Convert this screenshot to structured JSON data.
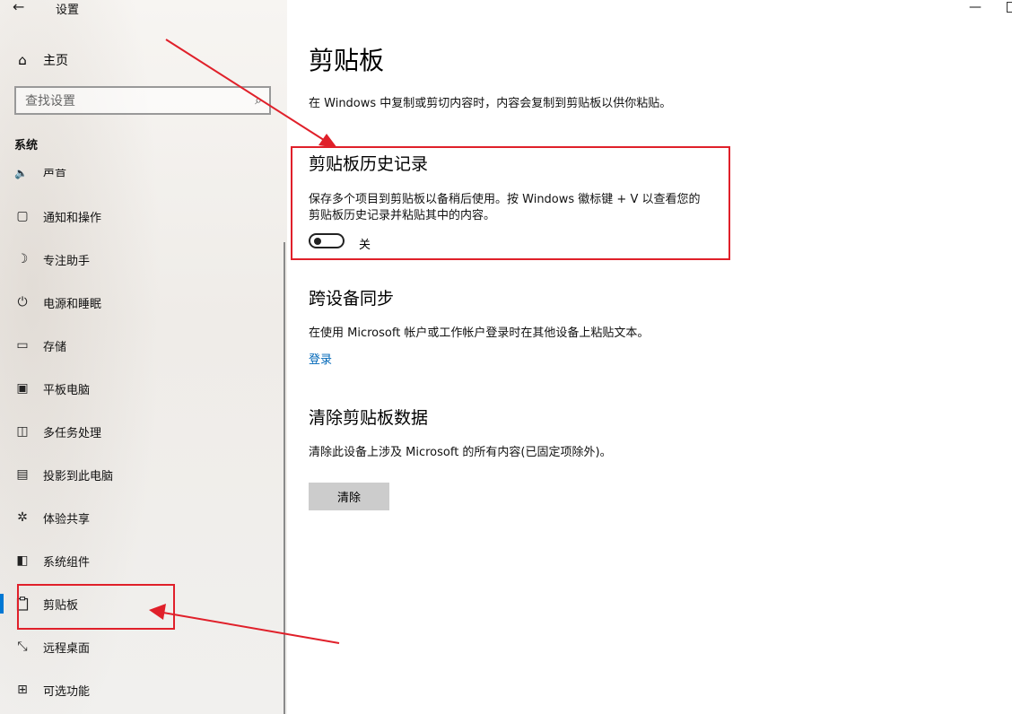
{
  "window": {
    "title": "设置",
    "back_icon": "back-arrow-icon",
    "minimize_glyph": "—"
  },
  "sidebar": {
    "home_label": "主页",
    "search_placeholder": "查找设置",
    "section": "系统",
    "partial_item": "声音",
    "items": [
      {
        "label": "通知和操作",
        "icon": "notification-icon",
        "glyph": "▢"
      },
      {
        "label": "专注助手",
        "icon": "moon-icon",
        "glyph": "☽"
      },
      {
        "label": "电源和睡眠",
        "icon": "power-icon",
        "glyph": "⏻"
      },
      {
        "label": "存储",
        "icon": "storage-icon",
        "glyph": "▭"
      },
      {
        "label": "平板电脑",
        "icon": "tablet-icon",
        "glyph": "▣"
      },
      {
        "label": "多任务处理",
        "icon": "multitask-icon",
        "glyph": "◫"
      },
      {
        "label": "投影到此电脑",
        "icon": "project-icon",
        "glyph": "▤"
      },
      {
        "label": "体验共享",
        "icon": "share-icon",
        "glyph": "✲"
      },
      {
        "label": "系统组件",
        "icon": "components-icon",
        "glyph": "◧"
      },
      {
        "label": "剪贴板",
        "icon": "clipboard-icon",
        "glyph": "📋",
        "selected": true
      },
      {
        "label": "远程桌面",
        "icon": "remote-desktop-icon",
        "glyph": "⤡"
      },
      {
        "label": "可选功能",
        "icon": "optional-features-icon",
        "glyph": "⊞"
      }
    ]
  },
  "main": {
    "title": "剪贴板",
    "description": "在 Windows 中复制或剪切内容时，内容会复制到剪贴板以供你粘贴。",
    "history": {
      "heading": "剪贴板历史记录",
      "text": "保存多个项目到剪贴板以备稍后使用。按 Windows 徽标键 + V 以查看您的剪贴板历史记录并粘贴其中的内容。",
      "toggle_state": "关",
      "toggle_on": false
    },
    "sync": {
      "heading": "跨设备同步",
      "text": "在使用 Microsoft 帐户或工作帐户登录时在其他设备上粘贴文本。",
      "link": "登录"
    },
    "clear": {
      "heading": "清除剪贴板数据",
      "text": "清除此设备上涉及 Microsoft 的所有内容(已固定项除外)。",
      "button": "清除"
    }
  },
  "colors": {
    "accent": "#0078d4",
    "link": "#0067b8",
    "annotation_red": "#e0202a",
    "button_bg": "#cccccc"
  }
}
